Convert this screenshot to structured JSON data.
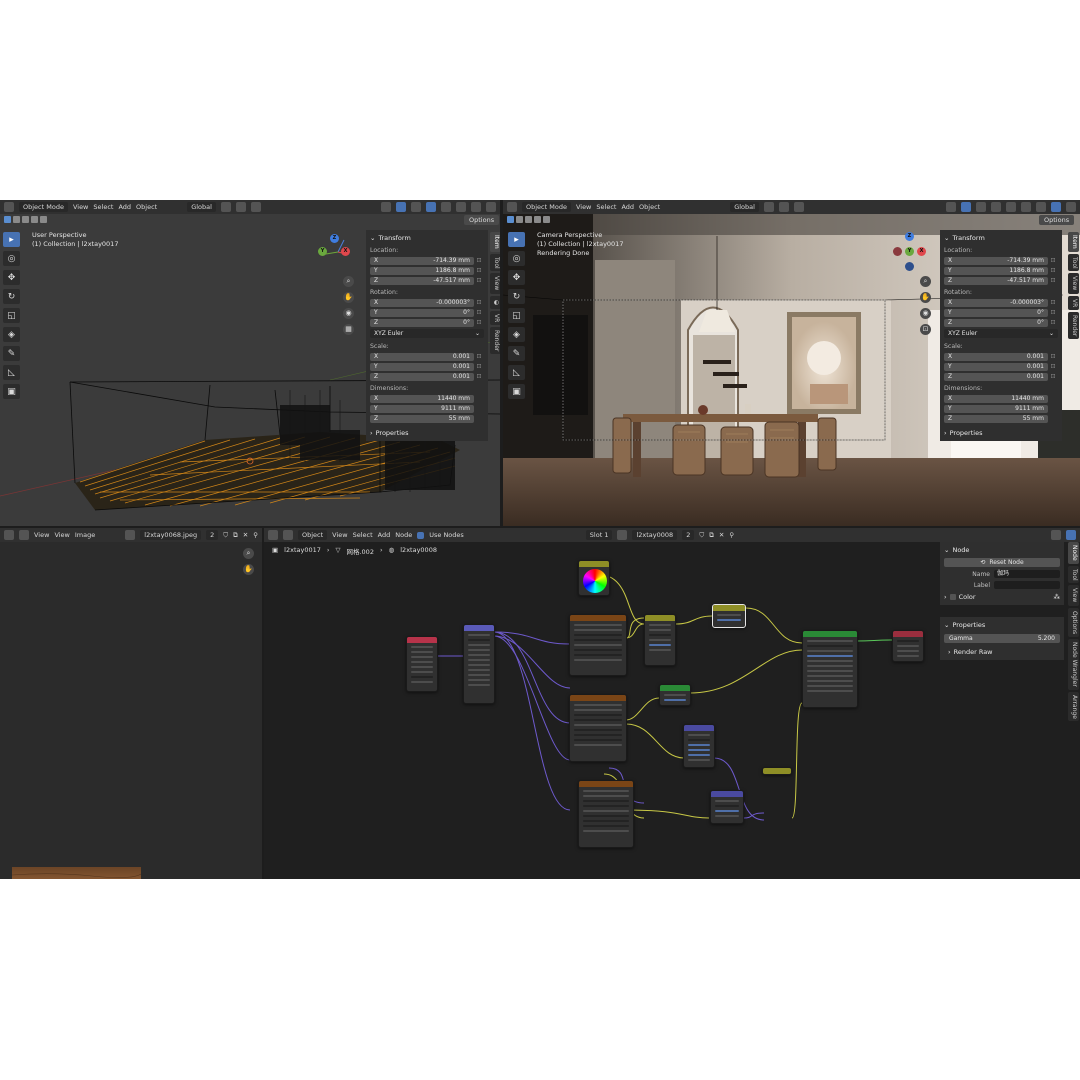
{
  "viewport_left": {
    "header": {
      "mode": "Object Mode",
      "menu": [
        "View",
        "Select",
        "Add",
        "Object"
      ],
      "orientation": "Global"
    },
    "options_label": "Options",
    "perspective": "User Perspective",
    "collection": "(1) Collection | l2xtay0017",
    "gizmo_labels": {
      "x": "X",
      "y": "Y",
      "z": "Z"
    },
    "tabs": [
      "Item",
      "Tool",
      "View",
      "",
      "VR",
      "Render"
    ]
  },
  "viewport_right": {
    "header": {
      "mode": "Object Mode",
      "menu": [
        "View",
        "Select",
        "Add",
        "Object"
      ],
      "orientation": "Global"
    },
    "options_label": "Options",
    "perspective": "Camera Perspective",
    "collection": "(1) Collection | l2xtay0017",
    "status": "Rendering Done",
    "gizmo_labels": {
      "x": "X",
      "y": "Y",
      "z": "Z"
    },
    "tabs": [
      "Item",
      "Tool",
      "View",
      "VR",
      "Render"
    ]
  },
  "transform": {
    "title": "Transform",
    "location_label": "Location:",
    "location": [
      {
        "axis": "X",
        "value": "-714.39 mm"
      },
      {
        "axis": "Y",
        "value": "1186.8 mm"
      },
      {
        "axis": "Z",
        "value": "-47.517 mm"
      }
    ],
    "rotation_label": "Rotation:",
    "rotation": [
      {
        "axis": "X",
        "value": "-0.000003°"
      },
      {
        "axis": "Y",
        "value": "0°"
      },
      {
        "axis": "Z",
        "value": "0°"
      }
    ],
    "rotation_mode": "XYZ Euler",
    "scale_label": "Scale:",
    "scale": [
      {
        "axis": "X",
        "value": "0.001"
      },
      {
        "axis": "Y",
        "value": "0.001"
      },
      {
        "axis": "Z",
        "value": "0.001"
      }
    ],
    "dimensions_label": "Dimensions:",
    "dimensions": [
      {
        "axis": "X",
        "value": "11440 mm"
      },
      {
        "axis": "Y",
        "value": "9111 mm"
      },
      {
        "axis": "Z",
        "value": "55 mm"
      }
    ],
    "properties_label": "Properties"
  },
  "image_editor": {
    "menu": [
      "View",
      "View",
      "Image"
    ],
    "image_name": "l2xtay0068.jpeg",
    "users": "2"
  },
  "node_editor": {
    "header": {
      "type": "Object",
      "menu": [
        "View",
        "Select",
        "Add",
        "Node"
      ],
      "use_nodes": "Use Nodes",
      "slot": "Slot 1",
      "material": "l2xtay0008",
      "users": "2"
    },
    "breadcrumb": [
      "l2xtay0017",
      "网格.002",
      "l2xtay0008"
    ],
    "tabs": [
      "Node",
      "Tool",
      "View",
      "Options",
      "Node Wrangler",
      "Arrange"
    ]
  },
  "node_panel": {
    "title": "Node",
    "reset_button": "Reset Node",
    "name_label": "Name",
    "name_value": "伽玛",
    "label_label": "Label",
    "label_value": "",
    "color_label": "Color",
    "properties_title": "Properties",
    "gamma_label": "Gamma",
    "gamma_value": "5.200",
    "render_raw": "Render Raw"
  },
  "colors": {
    "accent": "#4772b3",
    "node_texcoord": "#b7334a",
    "node_mapping": "#5a5ab8",
    "node_image": "#7a4516",
    "node_color": "#8e8e26",
    "node_vector": "#4a4aa0",
    "node_shader": "#2a8a36",
    "node_output": "#9a2e3e",
    "wire_yellow": "#c8c846",
    "wire_purple": "#6e5acd",
    "wire_green": "#5ac85a"
  }
}
